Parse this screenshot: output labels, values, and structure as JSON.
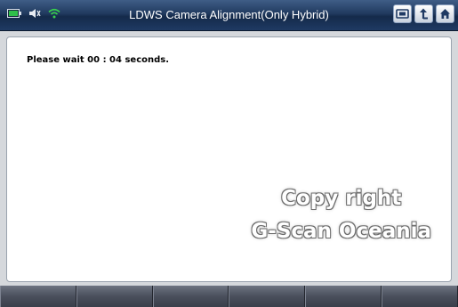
{
  "window": {
    "title": "LDWS Camera Alignment(Only Hybrid)"
  },
  "status_bar": {
    "icons": [
      "battery-icon",
      "speaker-icon",
      "wifi-icon"
    ]
  },
  "nav": {
    "buttons": [
      "screen-capture-icon",
      "back-icon",
      "home-icon"
    ]
  },
  "content": {
    "message": "Please wait 00 : 04 seconds."
  },
  "watermark": {
    "line1": "Copy right",
    "line2": "G-Scan Oceania"
  },
  "footer": {
    "buttons": [
      "",
      "",
      "",
      "",
      "",
      ""
    ]
  },
  "colors": {
    "title_bar": "#1f3a63",
    "battery": "#2fbf4a",
    "wifi": "#37d04d"
  }
}
